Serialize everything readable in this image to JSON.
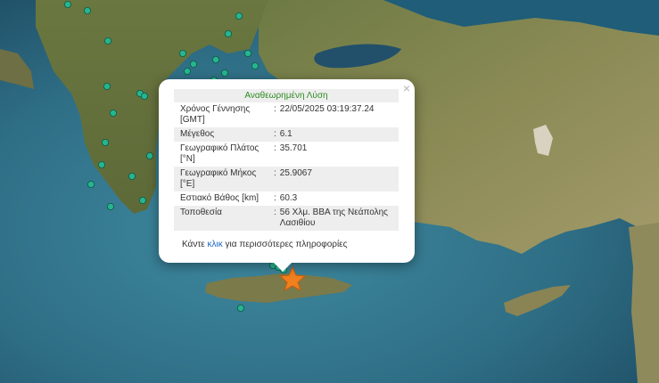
{
  "popup": {
    "title": "Αναθεωρημένη Λύση",
    "close_symbol": "×",
    "rows": [
      {
        "label": "Χρόνος Γέννησης [GMT]",
        "value": "22/05/2025 03:19:37.24"
      },
      {
        "label": "Μέγεθος",
        "value": "6.1"
      },
      {
        "label": "Γεωγραφικό Πλάτος [°N]",
        "value": "35.701"
      },
      {
        "label": "Γεωγραφικό Μήκος [°E]",
        "value": "25.9067"
      },
      {
        "label": "Εστιακό Βάθος [km]",
        "value": "60.3"
      },
      {
        "label": "Τοποθεσία",
        "value": "56 Χλμ. ΒΒΑ της Νεάπολης Λασιθίου"
      }
    ],
    "separator": ":",
    "footer_prefix": "Κάντε",
    "footer_link": "κλικ",
    "footer_suffix": "για περισσότερες πληροφορίες"
  },
  "map": {
    "sea_color": "#2f6f86",
    "land_color": "#6f7a44",
    "event_marker_color": "#f07f1e",
    "other_event_color": "#26b58f",
    "event_marker_icon": "star-icon",
    "other_event_icon": "circle-icon"
  }
}
